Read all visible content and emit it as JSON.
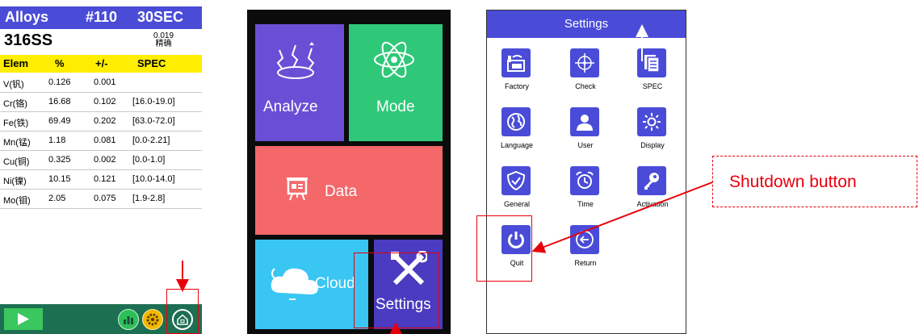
{
  "screen1": {
    "header": {
      "menu": "Alloys",
      "sample_no": "#110",
      "time": "30SEC"
    },
    "grade": {
      "name": "316SS",
      "match_value": "0.019",
      "match_label": "精确"
    },
    "table_headers": [
      "Elem",
      "%",
      "+/-",
      "SPEC"
    ],
    "rows": [
      {
        "elem": "V(钒)",
        "pct": "0.126",
        "err": "0.001",
        "spec": ""
      },
      {
        "elem": "Cr(铬)",
        "pct": "16.68",
        "err": "0.102",
        "spec": "[16.0-19.0]"
      },
      {
        "elem": "Fe(铁)",
        "pct": "69.49",
        "err": "0.202",
        "spec": "[63.0-72.0]"
      },
      {
        "elem": "Mn(锰)",
        "pct": "1.18",
        "err": "0.081",
        "spec": "[0.0-2.21]"
      },
      {
        "elem": "Cu(铜)",
        "pct": "0.325",
        "err": "0.002",
        "spec": "[0.0-1.0]"
      },
      {
        "elem": "Ni(镍)",
        "pct": "10.15",
        "err": "0.121",
        "spec": "[10.0-14.0]"
      },
      {
        "elem": "Mo(钼)",
        "pct": "2.05",
        "err": "0.075",
        "spec": "[1.9-2.8]"
      }
    ],
    "bottom_icons": [
      "play-icon",
      "chart-icon",
      "gear-icon",
      "home-icon"
    ]
  },
  "screen2": {
    "tiles": {
      "analyze": "Analyze",
      "mode": "Mode",
      "data": "Data",
      "cloud": "Cloud",
      "settings": "Settings"
    }
  },
  "screen3": {
    "title": "Settings",
    "items": [
      {
        "label": "Factory",
        "icon": "factory-icon"
      },
      {
        "label": "Check",
        "icon": "crosshair-icon"
      },
      {
        "label": "SPEC",
        "icon": "document-icon"
      },
      {
        "label": "Language",
        "icon": "globe-icon"
      },
      {
        "label": "User",
        "icon": "user-icon"
      },
      {
        "label": "Display",
        "icon": "brightness-icon"
      },
      {
        "label": "General",
        "icon": "shield-check-icon"
      },
      {
        "label": "Time",
        "icon": "alarm-clock-icon"
      },
      {
        "label": "Activation",
        "icon": "key-icon"
      },
      {
        "label": "Quit",
        "icon": "power-icon"
      },
      {
        "label": "Return",
        "icon": "back-arrow-icon"
      }
    ]
  },
  "annotation": {
    "callout": "Shutdown button"
  },
  "colors": {
    "primary": "#4a4cd8",
    "yellow_header": "#ffee00",
    "footer_green": "#1d6f52",
    "analyze_tile": "#6a4fd6",
    "mode_tile": "#2fc879",
    "data_tile": "#f4686a",
    "cloud_tile": "#39c6f3",
    "settings_tile": "#4a3bc0",
    "annotation_red": "#e8000b"
  }
}
